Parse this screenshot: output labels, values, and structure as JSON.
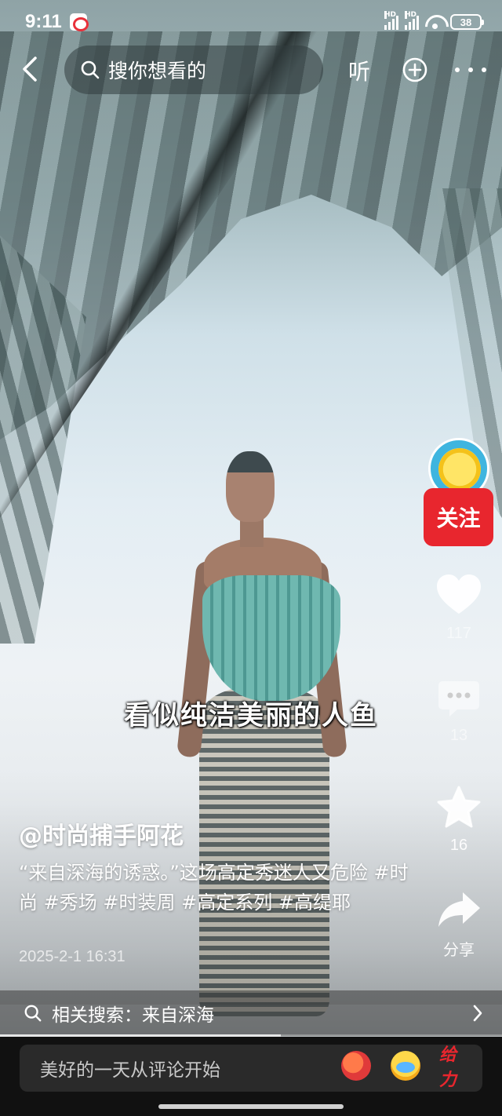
{
  "status_bar": {
    "time": "9:11",
    "battery": "38",
    "network_label": "HD"
  },
  "top_bar": {
    "search_placeholder": "搜你想看的",
    "listen_label": "听"
  },
  "video": {
    "caption": "看似纯洁美丽的人鱼",
    "progress_fraction": 0.56
  },
  "actions": {
    "follow_label": "关注",
    "like_count": "117",
    "comment_count": "13",
    "favorite_count": "16",
    "share_label": "分享"
  },
  "post": {
    "author": "@时尚捕手阿花",
    "description": "“来自深海的诱惑。”这场高定秀迷人又危险 #时尚 #秀场 #时装周 #高定系列 #高缇耶",
    "date": "2025-2-1 16:31"
  },
  "related_search": {
    "label": "相关搜索：来自深海"
  },
  "comment_bar": {
    "placeholder": "美好的一天从评论开始",
    "emoji_3_label": "给力"
  },
  "colors": {
    "follow_bg": "#e8262e",
    "avatar_bg": "#3fb5df"
  }
}
